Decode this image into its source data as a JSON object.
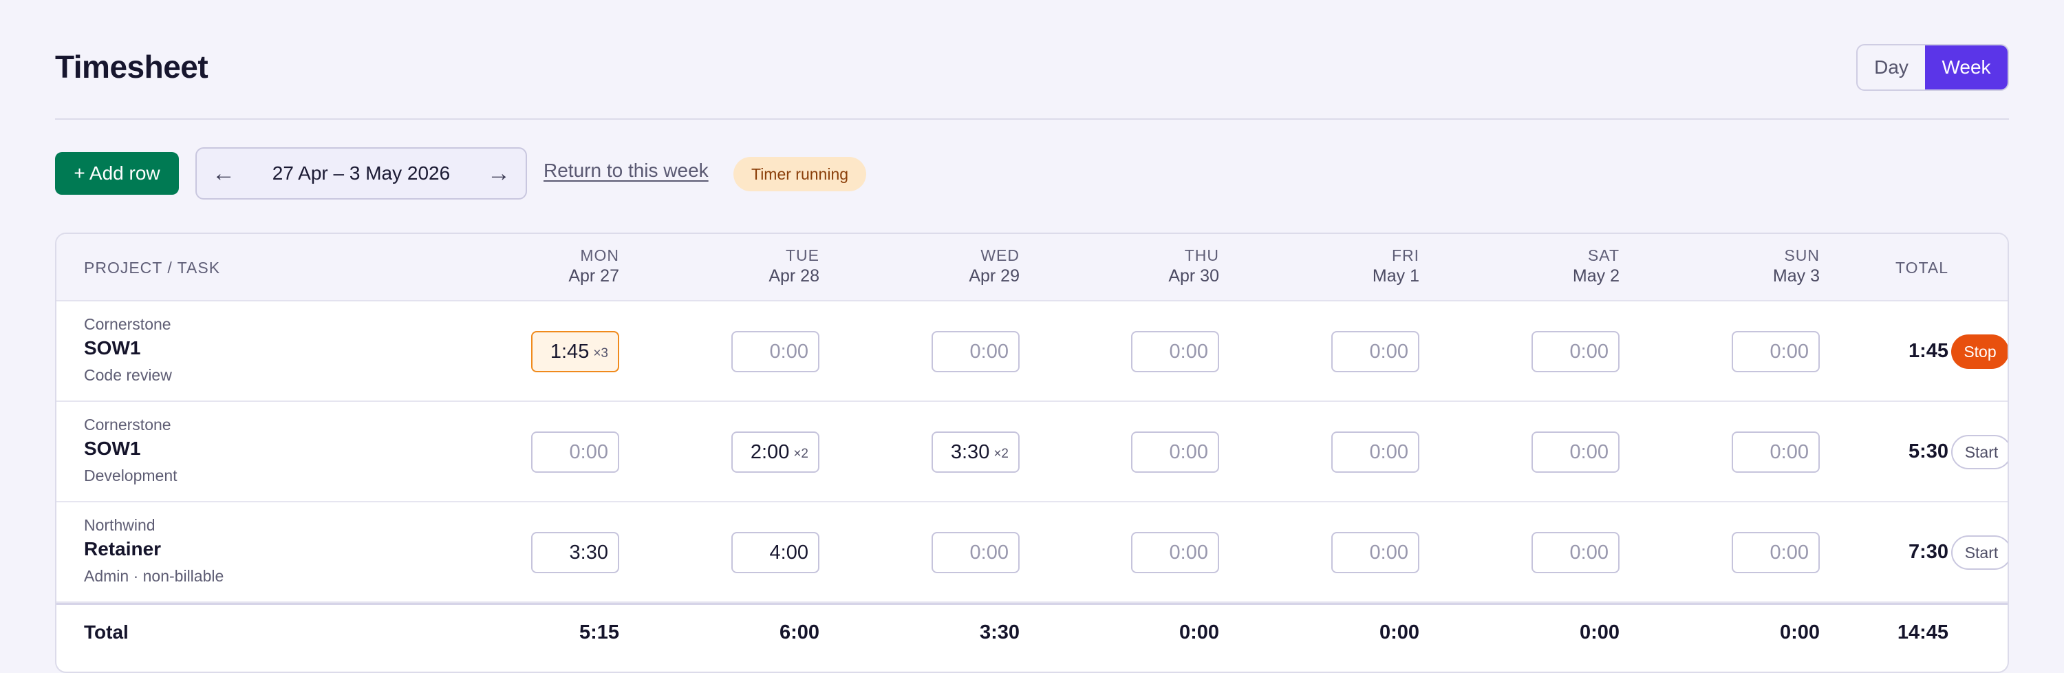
{
  "page": {
    "title": "Timesheet",
    "view_toggle": {
      "day_label": "Day",
      "week_label": "Week",
      "selected": "Week"
    },
    "accent_color": "#5b35e8"
  },
  "toolbar": {
    "add_row_label": "+ Add row",
    "prev_icon": "←",
    "next_icon": "→",
    "date_range": "27 Apr – 3 May 2026",
    "return_link": "Return to this week",
    "status_badge": "Timer running"
  },
  "table": {
    "headers": {
      "project_task": "PROJECT / TASK",
      "total": "TOTAL",
      "days": [
        {
          "weekday": "MON",
          "date": "Apr 27"
        },
        {
          "weekday": "TUE",
          "date": "Apr 28"
        },
        {
          "weekday": "WED",
          "date": "Apr 29"
        },
        {
          "weekday": "THU",
          "date": "Apr 30"
        },
        {
          "weekday": "FRI",
          "date": "May 1"
        },
        {
          "weekday": "SAT",
          "date": "May 2"
        },
        {
          "weekday": "SUN",
          "date": "May 3"
        }
      ]
    },
    "rows": [
      {
        "project": "Cornerstone",
        "task": "SOW1",
        "subtitle": "Code review",
        "cells": [
          {
            "value": "1:45",
            "count": "×3",
            "running": true
          },
          {
            "value": "0:00"
          },
          {
            "value": "0:00"
          },
          {
            "value": "0:00"
          },
          {
            "value": "0:00"
          },
          {
            "value": "0:00"
          },
          {
            "value": "0:00"
          }
        ],
        "total": "1:45",
        "action": "Stop"
      },
      {
        "project": "Cornerstone",
        "task": "SOW1",
        "subtitle": "Development",
        "cells": [
          {
            "value": "0:00"
          },
          {
            "value": "2:00",
            "count": "×2"
          },
          {
            "value": "3:30",
            "count": "×2"
          },
          {
            "value": "0:00"
          },
          {
            "value": "0:00"
          },
          {
            "value": "0:00"
          },
          {
            "value": "0:00"
          }
        ],
        "total": "5:30",
        "action": "Start"
      },
      {
        "project": "Northwind",
        "task": "Retainer",
        "subtitle": "Admin · non-billable",
        "cells": [
          {
            "value": "3:30"
          },
          {
            "value": "4:00"
          },
          {
            "value": "0:00"
          },
          {
            "value": "0:00"
          },
          {
            "value": "0:00"
          },
          {
            "value": "0:00"
          },
          {
            "value": "0:00"
          }
        ],
        "total": "7:30",
        "action": "Start"
      }
    ],
    "totals": {
      "label": "Total",
      "days": [
        "5:15",
        "6:00",
        "3:30",
        "0:00",
        "0:00",
        "0:00",
        "0:00"
      ],
      "grand_total": "14:45"
    }
  }
}
